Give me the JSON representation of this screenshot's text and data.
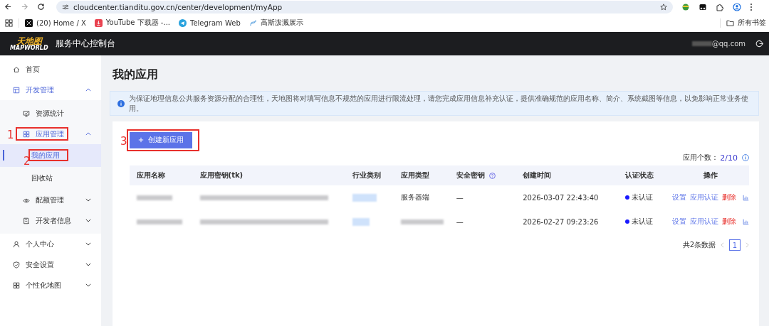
{
  "browser": {
    "url": "cloudcenter.tianditu.gov.cn/center/development/myApp",
    "bookmarks": [
      {
        "label": "(20) Home / X"
      },
      {
        "label": "YouTube 下载器 -..."
      },
      {
        "label": "Telegram Web"
      },
      {
        "label": "高斯泼溅展示"
      }
    ],
    "all_bookmarks": "所有书签"
  },
  "header": {
    "logo_top": "天地图",
    "logo_bottom": "MAPWORLD",
    "title": "服务中心控制台",
    "user": "@qq.com"
  },
  "sidebar": {
    "items": [
      {
        "label": "首页",
        "selected": false
      },
      {
        "label": "开发管理",
        "selected": false,
        "expanded": true,
        "children": [
          {
            "label": "资源统计",
            "selected": false
          },
          {
            "label": "应用管理",
            "selected": false,
            "expanded": true,
            "annotation": "1",
            "children": [
              {
                "label": "我的应用",
                "selected": true,
                "annotation": "2"
              },
              {
                "label": "回收站",
                "selected": false
              }
            ]
          },
          {
            "label": "配额管理",
            "selected": false,
            "expanded": false
          },
          {
            "label": "开发者信息",
            "selected": false,
            "expanded": false
          }
        ]
      },
      {
        "label": "个人中心",
        "selected": false,
        "expanded": false
      },
      {
        "label": "安全设置",
        "selected": false,
        "expanded": false
      },
      {
        "label": "个性化地图",
        "selected": false,
        "expanded": false
      }
    ]
  },
  "page_title": "我的应用",
  "notice": "为保证地理信息公共服务资源分配的合理性，天地图将对填写信息不规范的应用进行限流处理，请您完成应用信息补充认证，提供准确规范的应用名称、简介、系统截图等信息，以免影响正常业务使用。",
  "create_button": {
    "label": "创建新应用",
    "annotation": "3"
  },
  "app_count": {
    "label": "应用个数：",
    "value": "2/10"
  },
  "table": {
    "columns": [
      "应用名称",
      "应用密钥(tk)",
      "行业类别",
      "应用类型",
      "安全密钥",
      "创建时间",
      "认证状态",
      "操作"
    ],
    "rows": [
      {
        "name": {
          "kind": "blurred"
        },
        "key": {
          "kind": "blurred"
        },
        "industry": {
          "kind": "blurred-tag"
        },
        "type": {
          "kind": "text",
          "text": "服务器端"
        },
        "secret": "—",
        "created": "2026-03-07 22:43:40",
        "status": "未认证",
        "actions": [
          "设置",
          "应用认证",
          "删除"
        ]
      },
      {
        "name": {
          "kind": "blurred"
        },
        "key": {
          "kind": "blurred"
        },
        "industry": {
          "kind": "blurred-tag"
        },
        "type": {
          "kind": "blurred"
        },
        "secret": "—",
        "created": "2026-02-27 09:23:26",
        "status": "未认证",
        "actions": [
          "设置",
          "应用认证",
          "删除"
        ]
      }
    ]
  },
  "pagination": {
    "total": "共2条数据",
    "pages": [
      {
        "label": "1",
        "selected": true
      }
    ]
  }
}
